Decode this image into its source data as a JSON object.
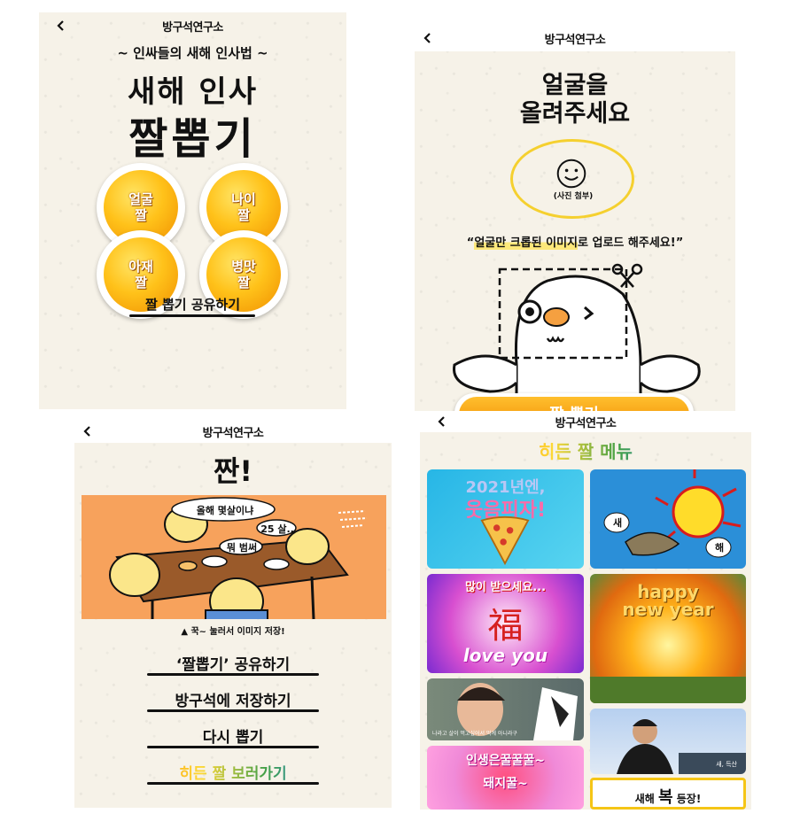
{
  "app": {
    "title": "방구석연구소",
    "back_glyph": "<"
  },
  "screen1": {
    "subtitle": "~ 인싸들의 새해 인사법 ~",
    "title_line1": "새해 인사",
    "title_line2": "짤뽑기",
    "buttons": [
      {
        "line1": "얼굴",
        "line2": "짤"
      },
      {
        "line1": "나이",
        "line2": "짤"
      },
      {
        "line1": "아재",
        "line2": "짤"
      },
      {
        "line1": "병맛",
        "line2": "짤"
      }
    ],
    "share_label": "짤 뽑기 공유하기"
  },
  "screen2": {
    "title_line1": "얼굴을",
    "title_line2": "올려주세요",
    "upload_caption": "(사진 첨부)",
    "instruction_hl": "얼굴만 크롭된 이미지",
    "instruction_rest": "로 업로드 해주세요!",
    "instruction_open": "“",
    "instruction_close": "”",
    "cta_partial": "짤 뽑기"
  },
  "screen3": {
    "title": "짠!",
    "bubble1": "올해 몇살이냐",
    "bubble2": "25 살..",
    "bubble3": "뭐 범써",
    "save_hint": "▲ 꾹~ 눌러서 이미지 저장!",
    "actions": [
      "‘짤뽑기’ 공유하기",
      "방구석에 저장하기",
      "다시 뽑기"
    ],
    "hidden_link": "히든 짤 보러가기"
  },
  "screen4": {
    "title": "히든 짤 메뉴",
    "tiles": {
      "pizza_text1": "2021년엔,",
      "pizza_text2": "웃음피자!",
      "bird_left": "새",
      "bird_right": "해",
      "bless_text": "많이 받으세요...",
      "fu_char": "福",
      "love_text": "love you",
      "happy_line1": "happy",
      "happy_line2": "new year",
      "drama_caption": "나라고    살이 먹고싶어서 먹게 아니라구",
      "pink_text1": "인생은꿀꿀꿀~",
      "pink_text2": "돼지꿀~",
      "man_caption": "새, 득산",
      "bok_pre": "새해",
      "bok_char": "복",
      "bok_post": "등장!"
    }
  },
  "colors": {
    "paper": "#f6f2e8",
    "yolk": "#ffc21a",
    "orange": "#f7a25c",
    "highlight": "#fde87a"
  }
}
